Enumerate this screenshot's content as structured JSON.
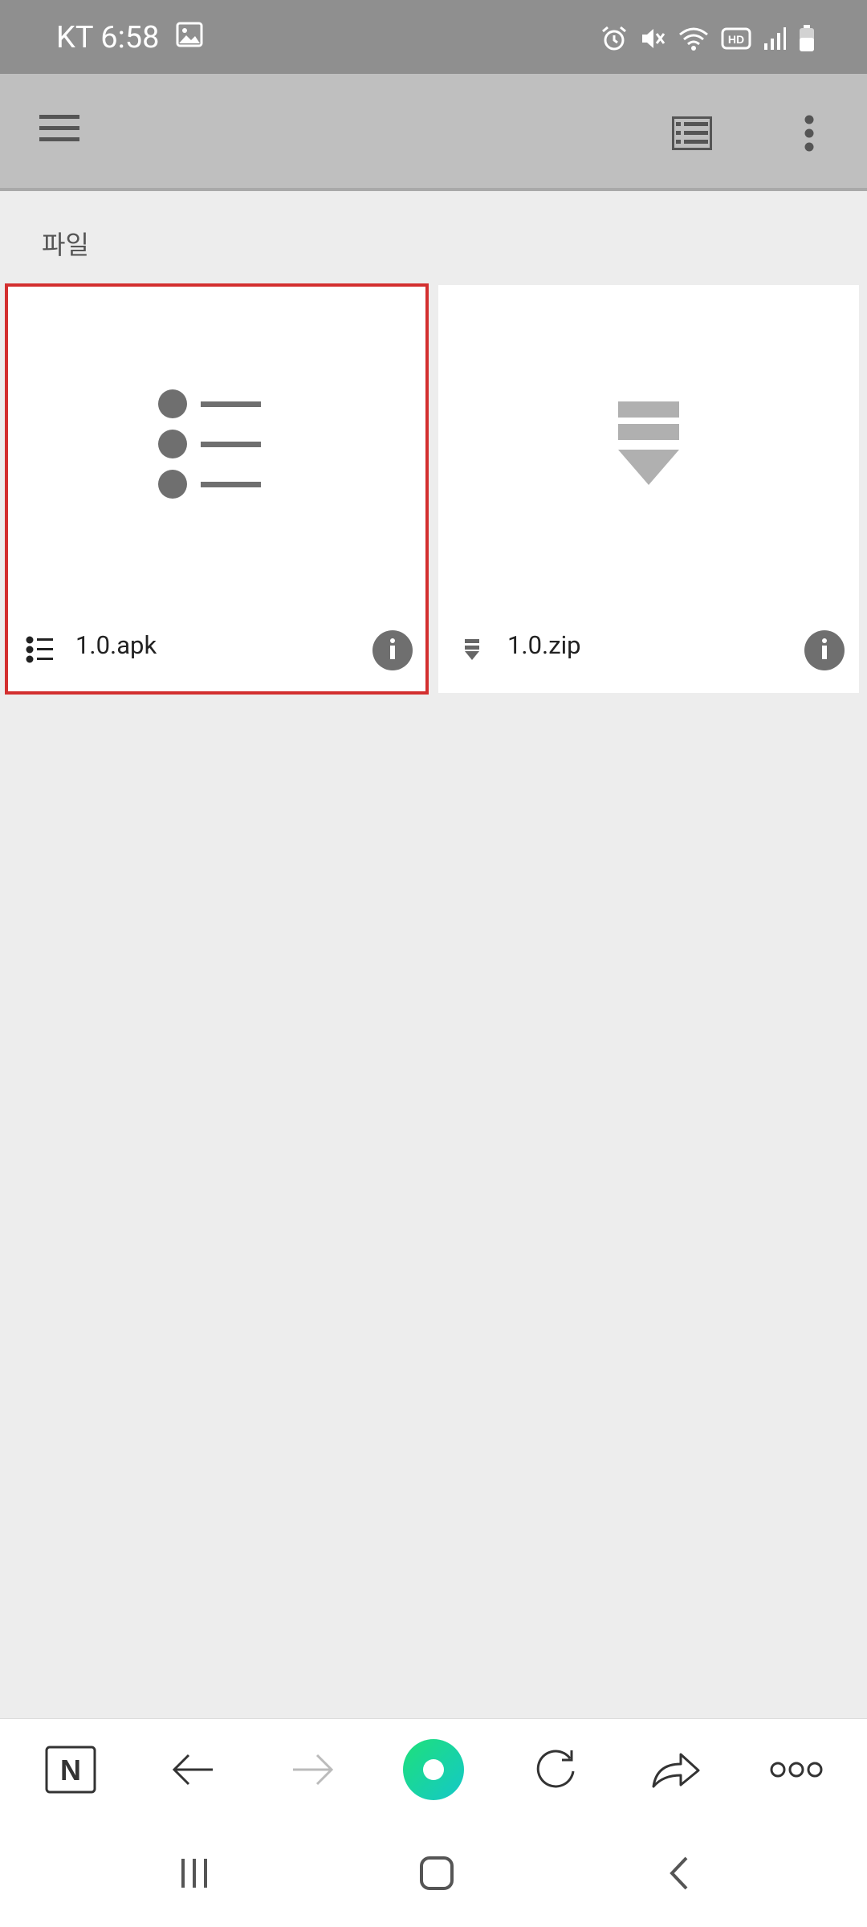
{
  "status_bar": {
    "carrier": "KT",
    "time": "6:58",
    "icons": [
      "image-icon",
      "alarm-icon",
      "mute-icon",
      "wifi-icon",
      "hd-voice-icon",
      "signal-icon",
      "battery-icon"
    ],
    "hd_label": "HD"
  },
  "app_bar": {
    "icons": [
      "menu-icon",
      "list-view-icon",
      "more-vert-icon"
    ]
  },
  "section": {
    "title": "파일"
  },
  "files": [
    {
      "name": "1.0.apk",
      "type_icon": "list-icon",
      "selected": true
    },
    {
      "name": "1.0.zip",
      "type_icon": "archive-download-icon",
      "selected": false
    }
  ],
  "browser_toolbar": {
    "n_label": "N",
    "icons": [
      "naver-n-icon",
      "back-arrow-icon",
      "forward-arrow-icon",
      "green-dot-icon",
      "refresh-icon",
      "share-icon",
      "more-horiz-icon"
    ]
  },
  "system_nav": {
    "icons": [
      "recent-apps-icon",
      "home-icon",
      "back-icon"
    ]
  },
  "colors": {
    "status_bar_bg": "#8f8f8f",
    "app_bar_bg": "#bfbfbf",
    "page_bg": "#ededed",
    "selection": "#d32f2f",
    "icon_gray": "#6f6f6f",
    "accent_green": "#20d080"
  }
}
